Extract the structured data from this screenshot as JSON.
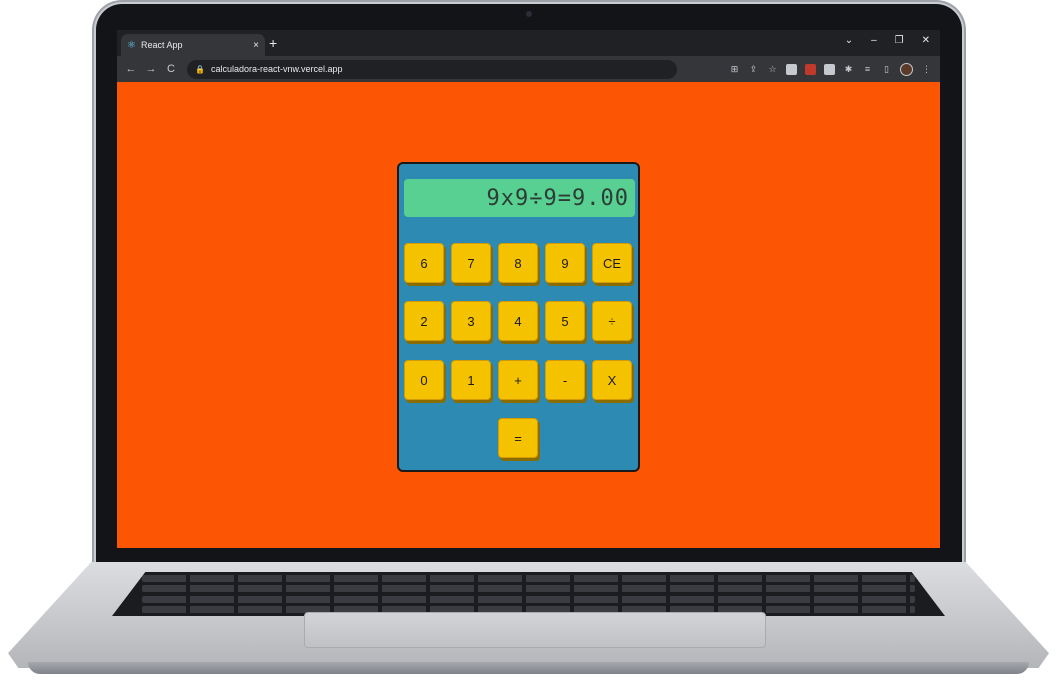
{
  "browser": {
    "tab_title": "React App",
    "tab_close": "×",
    "new_tab": "+",
    "window_controls": {
      "minimize": "–",
      "restore": "❐",
      "close": "✕",
      "dropdown": "⌄"
    },
    "nav": {
      "back": "←",
      "forward": "→",
      "reload": "C"
    },
    "url": "calculadora-react-vnw.vercel.app"
  },
  "calculator": {
    "display": "9x9÷9=9.00",
    "keys": [
      [
        "6",
        "7",
        "8",
        "9",
        "CE"
      ],
      [
        "2",
        "3",
        "4",
        "5",
        "÷"
      ],
      [
        "0",
        "1",
        "+",
        "-",
        "X"
      ],
      [
        "="
      ]
    ]
  },
  "colors": {
    "page_background": "#fc5605",
    "calculator_body": "#2c8ab3",
    "display": "#57d092",
    "key": "#f5c200"
  }
}
